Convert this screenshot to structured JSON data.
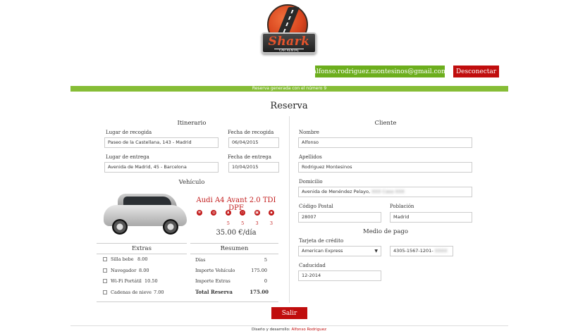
{
  "logo": {
    "title": "Shark",
    "subtitle": "CAR RENTAL"
  },
  "header": {
    "email": "alfonso.rodriguez.montesinos@gmail.com",
    "logout_label": "Desconectar"
  },
  "banner": "Reserva generada con el número 9",
  "page_title": "Reserva",
  "itinerario": {
    "title": "Itinerario",
    "pickup_place_label": "Lugar de recogida",
    "pickup_place": "Paseo de la Castellana, 143 - Madrid",
    "pickup_date_label": "Fecha de recogida",
    "pickup_date": "06/04/2015",
    "dropoff_place_label": "Lugar de entrega",
    "dropoff_place": "Avenida de Madrid, 45 - Barcelona",
    "dropoff_date_label": "Fecha de entrega",
    "dropoff_date": "10/04/2015"
  },
  "vehiculo": {
    "title": "Vehículo",
    "name": "Audi A4 Avant 2.0 TDI DPF",
    "features": [
      {
        "icon": "air-conditioning-icon",
        "value": ""
      },
      {
        "icon": "gps-icon",
        "value": ""
      },
      {
        "icon": "seats-icon",
        "value": "5"
      },
      {
        "icon": "doors-icon",
        "value": "5"
      },
      {
        "icon": "large-luggage-icon",
        "value": "3"
      },
      {
        "icon": "small-luggage-icon",
        "value": "3"
      }
    ],
    "price": "35.00 €/día"
  },
  "extras": {
    "title": "Extras",
    "items": [
      {
        "label": "Silla bebe",
        "price": "8.00"
      },
      {
        "label": "Navegador",
        "price": "8.00"
      },
      {
        "label": "Wi-Fi Portátil",
        "price": "10.50"
      },
      {
        "label": "Cadenas de nieve",
        "price": "7.00"
      }
    ]
  },
  "resumen": {
    "title": "Resumen",
    "rows": [
      {
        "label": "Días",
        "value": "5"
      },
      {
        "label": "Importe Vehículo",
        "value": "175.00"
      },
      {
        "label": "Importe Extras",
        "value": "0"
      }
    ],
    "total_label": "Total Reserva",
    "total_value": "175.00"
  },
  "cliente": {
    "title": "Cliente",
    "nombre_label": "Nombre",
    "nombre": "Alfonso",
    "apellidos_label": "Apellidos",
    "apellidos": "Rodriguez Montesinos",
    "domicilio_label": "Domicilio",
    "domicilio": "Avenida de Menéndez Pelayo,",
    "domicilio_hidden": "XXX Casa XXX",
    "cp_label": "Código Postal",
    "cp": "28007",
    "poblacion_label": "Población",
    "poblacion": "Madrid"
  },
  "pago": {
    "title": "Medio de pago",
    "tarjeta_label": "Tarjeta de crédito",
    "tarjeta": "American Express",
    "numero": "4305-1567-1201-",
    "numero_hidden": "XXXX",
    "caducidad_label": "Caducidad",
    "caducidad": "12-2014"
  },
  "salir_label": "Salir",
  "footer": {
    "text": "Diseño y desarrollo: ",
    "author": "Alfonso Rodriguez"
  },
  "colors": {
    "green": "#6cae1d",
    "red": "#c00d0d",
    "banner": "#86bd36"
  }
}
